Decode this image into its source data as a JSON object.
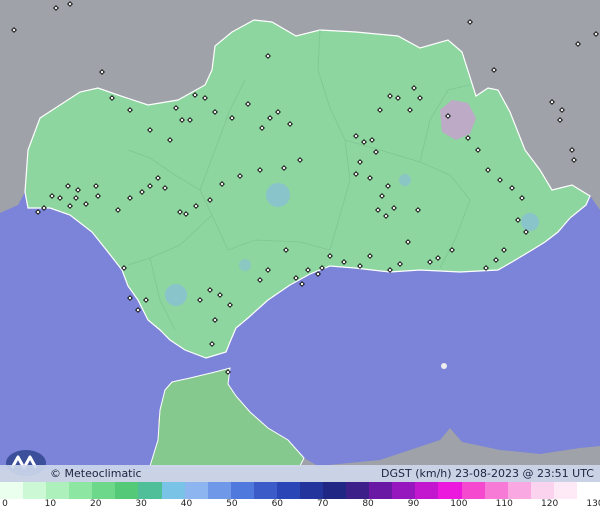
{
  "brand": {
    "label": "© Meteoclimatic"
  },
  "caption": {
    "variable": "DGST",
    "unit": "(km/h)",
    "datetime": "23-08-2023 @ 23:51 UTC"
  },
  "colors": {
    "sea": "#7b84d9",
    "land_outside": "#9fa2a8",
    "andalusia": "#8ed6a0",
    "africa": "#86c98f",
    "border": "#ffffff"
  },
  "scale": {
    "ticks": [
      "0",
      "10",
      "20",
      "30",
      "40",
      "50",
      "60",
      "70",
      "80",
      "90",
      "100",
      "110",
      "120",
      "130"
    ],
    "colors": [
      "#eaffee",
      "#cdf8d5",
      "#aef0bc",
      "#8ee6a3",
      "#6ed88a",
      "#54c978",
      "#4fbf99",
      "#79c3e6",
      "#8db6f0",
      "#6f98e8",
      "#4f79dc",
      "#3b5cc8",
      "#2a46b6",
      "#24349d",
      "#1f2683",
      "#3d1f8a",
      "#6a19a4",
      "#9617bd",
      "#c316cf",
      "#ec18de",
      "#f54ad0",
      "#f77ad6",
      "#f9a8e2",
      "#fbd3ee",
      "#fdeaf6",
      "#ffffff"
    ]
  }
}
